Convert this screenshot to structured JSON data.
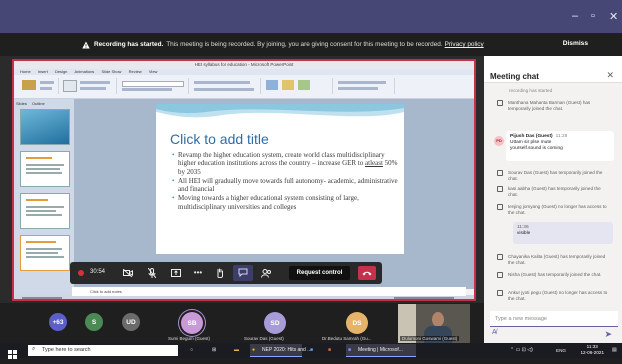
{
  "window": {
    "minimize": "–",
    "restore": "▫",
    "close": "✕"
  },
  "banner": {
    "bold": "Recording has started.",
    "message": "This meeting is being recorded. By joining, you are giving consent for this meeting to be recorded.",
    "link": "Privacy policy",
    "dismiss": "Dismiss"
  },
  "powerpoint": {
    "title": "HEI syllabus for education - Microsoft PowerPoint",
    "tabs": [
      "Home",
      "Insert",
      "Design",
      "Animations",
      "Slide Show",
      "Review",
      "View"
    ],
    "panel_tabs": [
      "Slides",
      "Outline"
    ],
    "notes_placeholder": "Click to add notes"
  },
  "slide": {
    "title": "Click to add title",
    "bullets": [
      {
        "pre": "Revamp the higher education system, create world class multidisciplinary higher education institutions across the country – increase GER to ",
        "underline": "atleast",
        "post": " 50% by 2035"
      },
      {
        "pre": "All HEI will gradually move towards full autonomy- academic, administrative and financial",
        "underline": "",
        "post": ""
      },
      {
        "pre": "Moving towards a higher educational system consisting of large, multidisciplinary universities and colleges",
        "underline": "",
        "post": ""
      }
    ]
  },
  "controls": {
    "timer": "30:54",
    "request_control": "Request control"
  },
  "participants": [
    {
      "initials": "+63",
      "name": "",
      "color": "#5b5fc7"
    },
    {
      "initials": "S",
      "name": "",
      "color": "#4b8a55"
    },
    {
      "initials": "UD",
      "name": "",
      "color": "#6b6b6b"
    },
    {
      "initials": "SB",
      "name": "Sumi Begum (Guest)",
      "color": "#c89ad8"
    },
    {
      "initials": "SD",
      "name": "Sourav Das (Guest)",
      "color": "#a99bd8"
    },
    {
      "initials": "DS",
      "name": "Dr.Bedutu Samrah (Gu...",
      "color": "#e6b36a"
    },
    {
      "initials": "",
      "name": "Dulumoni Goswami (Guest)",
      "color": ""
    }
  ],
  "chat": {
    "title": "Meeting chat",
    "top_line": "recording has started",
    "items": [
      {
        "kind": "event",
        "text": "Manthana Mahanta Barman (Guest) has temporarily joined the chat."
      },
      {
        "kind": "message",
        "initials": "PD",
        "name": "Pijush Das (Guest)",
        "time": "11:28",
        "lines": [
          "Uttam sir plse mute",
          "yourself.sound is coming"
        ]
      },
      {
        "kind": "event",
        "text": "Sourav Das (Guest) has temporarily joined the chat."
      },
      {
        "kind": "event",
        "text": "kasi aabha (Guest) has temporarily joined the chat."
      },
      {
        "kind": "event",
        "text": "tenjing jomyang (Guest) no longer has access to the chat."
      },
      {
        "kind": "mine",
        "time": "11:36",
        "text": "visible"
      },
      {
        "kind": "event",
        "text": "Chayanika Kalita (Guest) has temporarily joined the chat."
      },
      {
        "kind": "event",
        "text": "Nisha (Guest) has temporarily joined the chat."
      },
      {
        "kind": "event",
        "text": "Ankur jyoti pegu (Guest) no longer has access to the chat."
      }
    ],
    "compose_placeholder": "Type a new message"
  },
  "taskbar": {
    "search_placeholder": "Type here to search",
    "apps": [
      "NEP 2020: Hits and ...",
      "Meeting | Microsof..."
    ],
    "tray": "ENG",
    "time": "11:33",
    "date": "12-06-2021"
  },
  "colors": {
    "teams_purple": "#464775",
    "record_red": "#c4314b",
    "slide_title_blue": "#2c6da8"
  }
}
